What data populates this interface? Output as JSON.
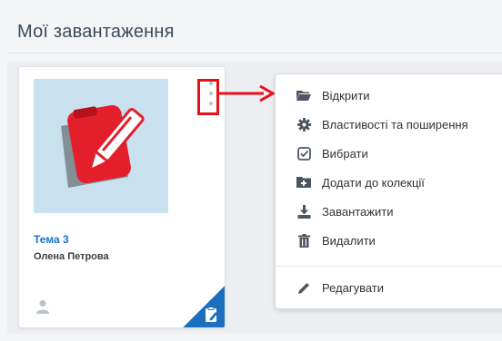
{
  "page": {
    "title": "Мої завантаження"
  },
  "card": {
    "title": "Тема 3",
    "author": "Олена Петрова",
    "thumbnail_icon": "edit-document-icon",
    "thumbnail_bg": "#c9e0ef",
    "corner_badge_icon": "clipboard-edit-icon",
    "corner_badge_color": "#1c6fbd"
  },
  "menu": {
    "items": [
      {
        "label": "Відкрити",
        "icon": "folder-open-icon"
      },
      {
        "label": "Властивості та поширення",
        "icon": "gear-icon"
      },
      {
        "label": "Вибрати",
        "icon": "checkbox-icon"
      },
      {
        "label": "Додати до колекції",
        "icon": "folder-plus-icon"
      },
      {
        "label": "Завантажити",
        "icon": "download-icon"
      },
      {
        "label": "Видалити",
        "icon": "trash-icon"
      }
    ],
    "edit": {
      "label": "Редагувати",
      "icon": "pencil-icon"
    }
  },
  "annotation": {
    "color": "#e8101a"
  }
}
